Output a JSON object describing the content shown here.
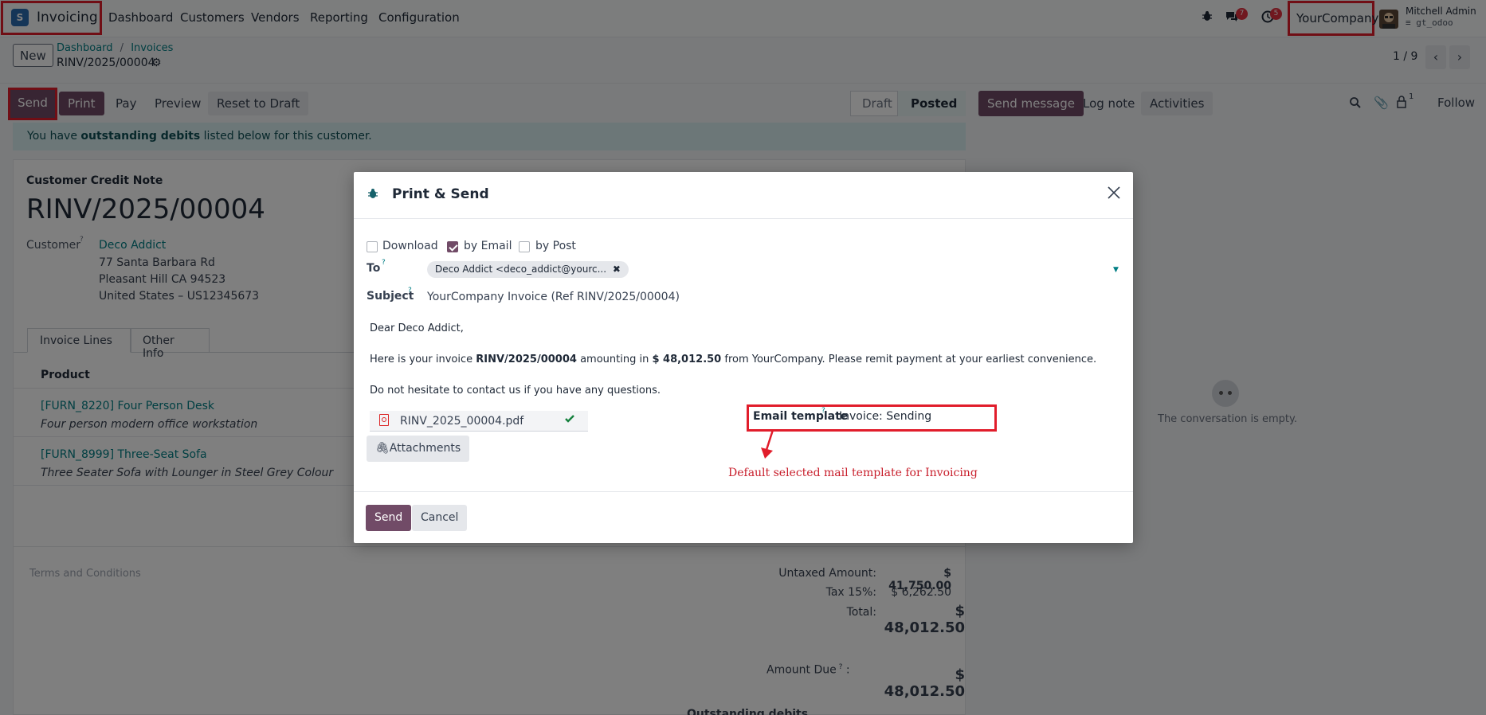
{
  "navbar": {
    "app_icon": "S",
    "app_name": "Invoicing",
    "menu": [
      "Dashboard",
      "Customers",
      "Vendors",
      "Reporting",
      "Configuration"
    ],
    "messages_count": "7",
    "activities_count": "5",
    "company": "YourCompany",
    "user_name": "Mitchell Admin",
    "db_name": "gt_odoo"
  },
  "control_panel": {
    "new_label": "New",
    "breadcrumb_parent": "Dashboard",
    "breadcrumb_sep": "/",
    "breadcrumb_current": "Invoices",
    "record_name": "RINV/2025/00004",
    "pager": "1 / 9"
  },
  "actions": {
    "send": "Send",
    "print": "Print",
    "pay": "Pay",
    "preview": "Preview",
    "reset": "Reset to Draft"
  },
  "status": {
    "draft": "Draft",
    "posted": "Posted"
  },
  "chatter": {
    "send_message": "Send message",
    "log_note": "Log note",
    "activities": "Activities",
    "followers_count": "1",
    "follow": "Follow",
    "empty": "The conversation is empty."
  },
  "alert": {
    "before": "You have ",
    "bold": "outstanding debits",
    "after": " listed below for this customer."
  },
  "invoice": {
    "type_label": "Customer Credit Note",
    "number": "RINV/2025/00004",
    "customer_label": "Customer",
    "customer_name": "Deco Addict",
    "address_1": "77 Santa Barbara Rd",
    "address_2": "Pleasant Hill CA 94523",
    "address_3": "United States – US12345673",
    "tabs": [
      "Invoice Lines",
      "Other Info"
    ],
    "product_header": "Product",
    "lines": [
      {
        "product": "[FURN_8220] Four Person Desk",
        "desc": "Four person modern office workstation"
      },
      {
        "product": "[FURN_8999] Three-Seat Sofa",
        "desc": "Three Seater Sofa with Lounger in Steel Grey Colour"
      }
    ],
    "terms_placeholder": "Terms and Conditions",
    "untaxed_label": "Untaxed Amount:",
    "untaxed_value": "$ 41,750.00",
    "tax_label": "Tax 15%:",
    "tax_value": "$ 6,262.50",
    "total_label": "Total:",
    "total_value": "$ 48,012.50",
    "amount_due_label": "Amount Due",
    "amount_due_value": "$ 48,012.50",
    "outstanding_heading": "Outstanding debits"
  },
  "modal": {
    "title": "Print & Send",
    "options": {
      "download": "Download",
      "by_email": "by Email",
      "by_post": "by Post"
    },
    "to_label": "To",
    "recipient": "Deco Addict <deco_addict@yourc...",
    "subject_label": "Subject",
    "subject_value": "YourCompany Invoice (Ref RINV/2025/00004)",
    "body_greeting": "Dear Deco Addict,",
    "body_l1_a": "Here is your invoice ",
    "body_l1_b": "RINV/2025/00004",
    "body_l1_c": " amounting in ",
    "body_l1_d": "$ 48,012.50",
    "body_l1_e": " from YourCompany. Please remit payment at your earliest convenience.",
    "body_l2": "Do not hesitate to contact us if you have any questions.",
    "attachment_name": "RINV_2025_00004.pdf",
    "attachments_button": "Attachments",
    "template_label": "Email template",
    "template_value": "Invoice: Sending",
    "annotation": "Default selected mail template for Invoicing",
    "send_button": "Send",
    "cancel_button": "Cancel"
  }
}
